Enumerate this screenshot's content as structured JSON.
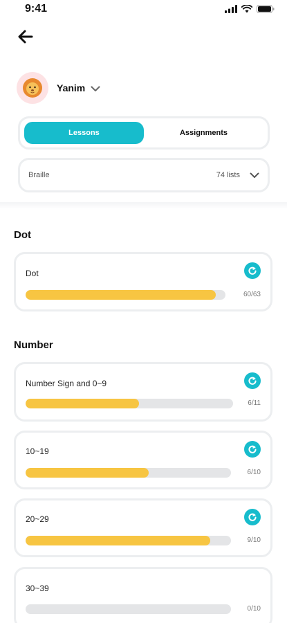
{
  "status_bar": {
    "time": "9:41",
    "icons": [
      "signal-icon",
      "wifi-icon",
      "battery-icon"
    ]
  },
  "header": {
    "back_icon": "arrow-left-icon"
  },
  "profile": {
    "name": "Yanim",
    "avatar_icon": "lion-icon"
  },
  "tabs": [
    {
      "label": "Lessons",
      "active": true
    },
    {
      "label": "Assignments",
      "active": false
    }
  ],
  "selector": {
    "value": "Braille",
    "count": "74 lists"
  },
  "sections": [
    {
      "title": "Dot",
      "items": [
        {
          "title": "Dot",
          "progress": "60/63",
          "fraction": 0.952,
          "has_icon": true
        }
      ]
    },
    {
      "title": "Number",
      "items": [
        {
          "title": "Number Sign and 0~9",
          "progress": "6/11",
          "fraction": 0.545,
          "has_icon": true
        },
        {
          "title": "10~19",
          "progress": "6/10",
          "fraction": 0.6,
          "has_icon": true
        },
        {
          "title": "20~29",
          "progress": "9/10",
          "fraction": 0.9,
          "has_icon": true
        },
        {
          "title": "30~39",
          "progress": "0/10",
          "fraction": 0,
          "has_icon": false
        }
      ]
    }
  ],
  "colors": {
    "accent": "#17bccc",
    "progress": "#f7c542",
    "track": "#e4e5e7",
    "border": "#eceef0"
  }
}
